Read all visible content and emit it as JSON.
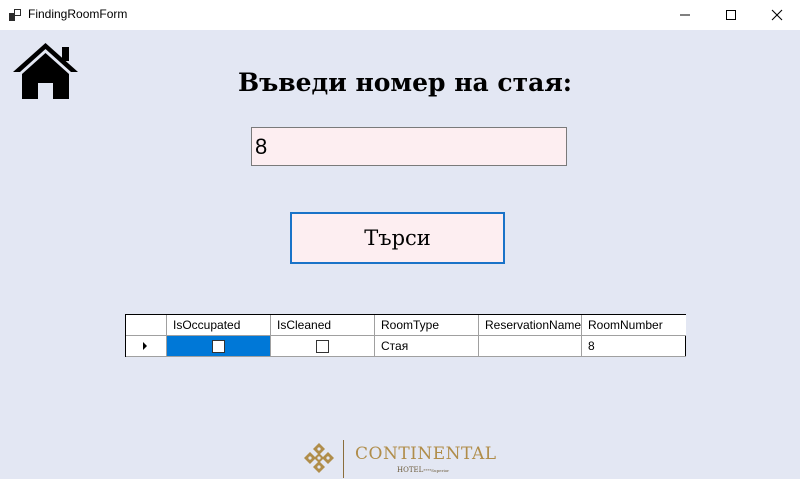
{
  "window": {
    "title": "FindingRoomForm",
    "controls": [
      "minimize-icon",
      "maximize-icon",
      "close-icon"
    ]
  },
  "form": {
    "heading": "Въведи номер на стая:",
    "room_input_value": "8",
    "search_button_label": "Търси",
    "home_icon": "home-icon",
    "colors": {
      "background": "#e3e7f3",
      "input_bg": "#fdeef1",
      "button_border": "#1a73c8",
      "selection": "#0078d7"
    }
  },
  "grid": {
    "columns": [
      "IsOccupated",
      "IsCleaned",
      "RoomType",
      "ReservationName",
      "RoomNumber"
    ],
    "rows": [
      {
        "IsOccupated": false,
        "IsCleaned": false,
        "RoomType": "Стая",
        "ReservationName": "",
        "RoomNumber": "8"
      }
    ]
  },
  "logo": {
    "name": "CONTINENTAL",
    "sub": "HOTEL",
    "sub_small": "****Superior"
  }
}
